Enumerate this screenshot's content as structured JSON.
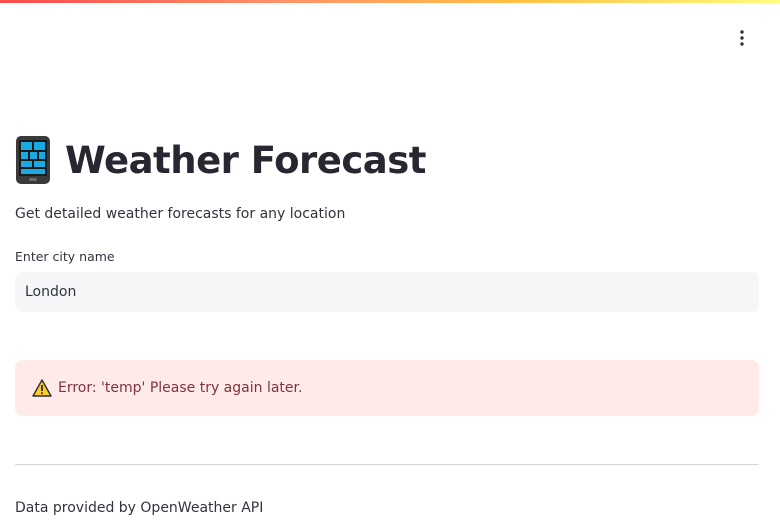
{
  "header": {
    "menu_icon": "vertical-ellipsis-icon"
  },
  "page": {
    "title_icon": "mobile-phone-icon",
    "title": "Weather Forecast",
    "subtitle": "Get detailed weather forecasts for any location"
  },
  "city_field": {
    "label": "Enter city name",
    "value": "London"
  },
  "alert": {
    "icon": "warning-icon",
    "message": "Error: 'temp' Please try again later."
  },
  "footer": {
    "text": "Data provided by OpenWeather API"
  },
  "colors": {
    "alert_background": "#ffe9e9",
    "alert_text": "#7d353b",
    "title": "#262730",
    "input_background": "#f5f6f8"
  }
}
